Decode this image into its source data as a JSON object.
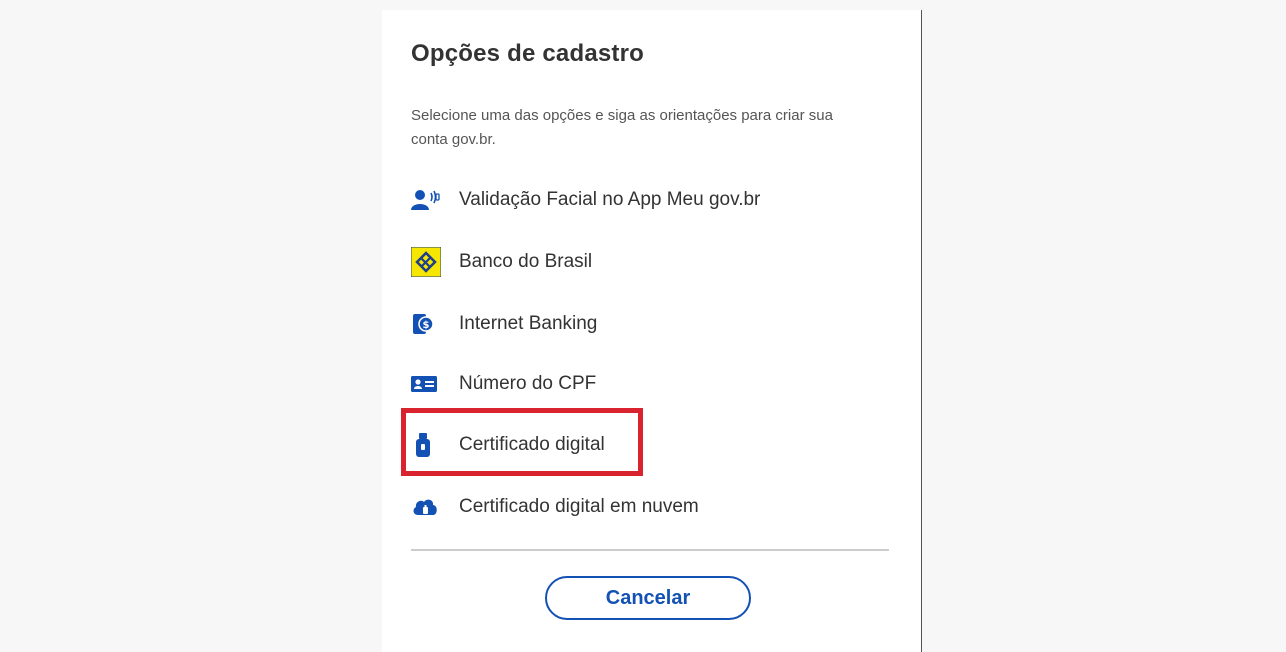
{
  "dialog": {
    "title": "Opções de cadastro",
    "subtitle": "Selecione uma das opções e siga as orientações para criar sua conta gov.br.",
    "options": [
      {
        "label": "Validação Facial no App Meu gov.br",
        "icon": "face-validation-icon"
      },
      {
        "label": "Banco do Brasil",
        "icon": "banco-do-brasil-logo-icon"
      },
      {
        "label": "Internet Banking",
        "icon": "internet-banking-icon"
      },
      {
        "label": "Número do CPF",
        "icon": "id-card-icon"
      },
      {
        "label": "Certificado digital",
        "icon": "usb-token-icon"
      },
      {
        "label": "Certificado digital em nuvem",
        "icon": "cloud-certificate-icon"
      }
    ],
    "cancel_label": "Cancelar"
  },
  "colors": {
    "primary": "#1351b4",
    "highlight": "#d9232e",
    "bb_yellow": "#f7e600",
    "text": "#333333"
  }
}
